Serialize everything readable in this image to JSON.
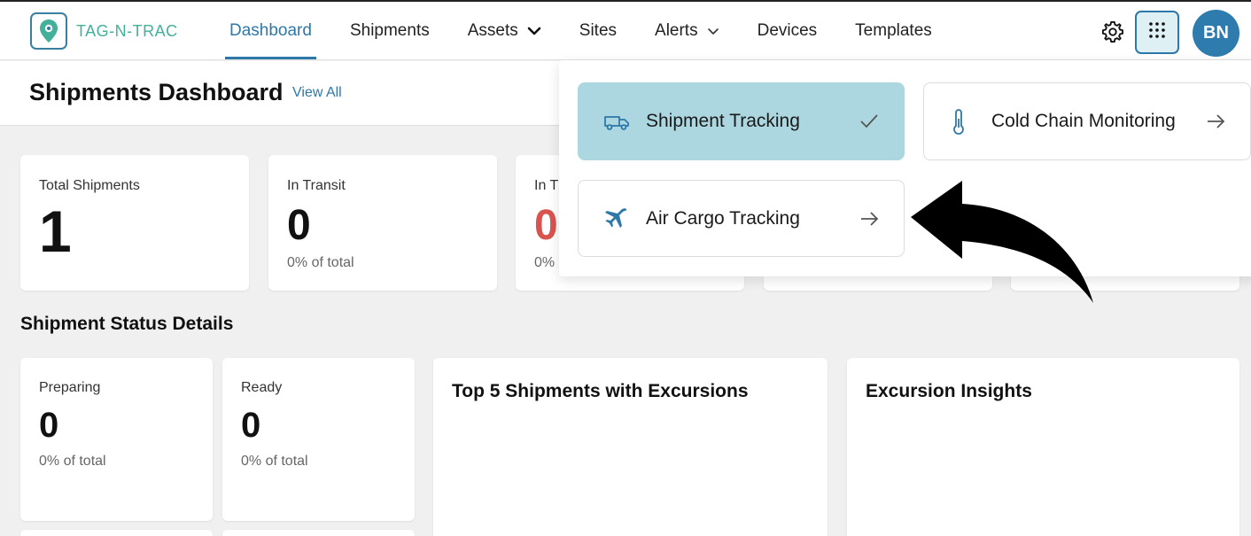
{
  "header": {
    "logo_text": "TAG-N-TRAC",
    "nav": [
      {
        "label": "Dashboard",
        "active": true
      },
      {
        "label": "Shipments"
      },
      {
        "label": "Assets",
        "dropdown": true
      },
      {
        "label": "Sites"
      },
      {
        "label": "Alerts",
        "dropdown": true
      },
      {
        "label": "Devices"
      },
      {
        "label": "Templates"
      }
    ],
    "avatar_initials": "BN"
  },
  "page": {
    "title": "Shipments Dashboard",
    "view_all": "View All"
  },
  "stats": [
    {
      "label": "Total Shipments",
      "value": "1",
      "sub": ""
    },
    {
      "label": "In Transit",
      "value": "0",
      "sub": "0% of total"
    },
    {
      "label": "In T",
      "value": "0",
      "sub": "0%"
    }
  ],
  "status_section": {
    "title": "Shipment Status Details",
    "cards": [
      {
        "label": "Preparing",
        "value": "0",
        "sub": "0% of total"
      },
      {
        "label": "Ready",
        "value": "0",
        "sub": "0% of total"
      }
    ]
  },
  "panels": {
    "top5_title": "Top 5 Shipments with Excursions",
    "insights_title": "Excursion Insights"
  },
  "apps_menu": {
    "items": [
      {
        "label": "Shipment Tracking",
        "icon": "truck-icon",
        "selected": true
      },
      {
        "label": "Cold Chain Monitoring",
        "icon": "thermometer-icon"
      },
      {
        "label": "Air Cargo Tracking",
        "icon": "airplane-icon"
      }
    ]
  },
  "colors": {
    "brand": "#2d78a8",
    "logo_green": "#43b09a",
    "selected_tile": "#acd7e0",
    "alert_red": "#d9534f"
  }
}
